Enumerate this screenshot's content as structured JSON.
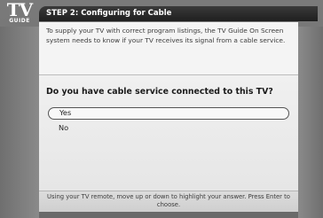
{
  "logo": {
    "line1": "TV",
    "line2": "GUIDE"
  },
  "header": {
    "title": "STEP 2: Configuring for Cable"
  },
  "intro": {
    "text": "To supply your TV with correct program listings, the TV Guide On Screen system needs to know if your TV receives its signal from a cable service."
  },
  "question": {
    "text": "Do you have cable service connected to this TV?"
  },
  "options": [
    {
      "label": "Yes",
      "selected": true
    },
    {
      "label": "No",
      "selected": false
    }
  ],
  "footer": {
    "text": "Using your TV remote, move up or down to highlight your answer.  Press Enter to choose."
  }
}
